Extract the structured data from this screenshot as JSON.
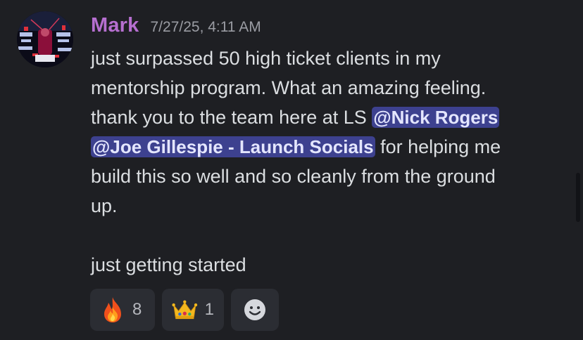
{
  "message": {
    "author": "Mark",
    "timestamp": "7/27/25, 4:11 AM",
    "lines": {
      "l1": "just surpassed 50 high ticket clients in my",
      "l2": "mentorship program. What an amazing feeling.",
      "l3_text": "thank you to the team here at LS ",
      "l3_mention": "@Nick Rogers",
      "l4_mention": "@Joe Gillespie - Launch Socials",
      "l4_text": " for helping me",
      "l5": "build this so well and so cleanly from the ground",
      "l6": "up.",
      "l8": "just getting started"
    }
  },
  "reactions": [
    {
      "emoji": "fire-icon",
      "count": "8"
    },
    {
      "emoji": "crown-icon",
      "count": "1"
    }
  ],
  "add_reaction_icon": "smiley-add-reaction-icon",
  "colors": {
    "background": "#1e1f23",
    "username": "#b66fd0",
    "timestamp": "#9a9ca3",
    "mention_bg": "#3d418f",
    "reaction_bg": "#2b2d33"
  }
}
